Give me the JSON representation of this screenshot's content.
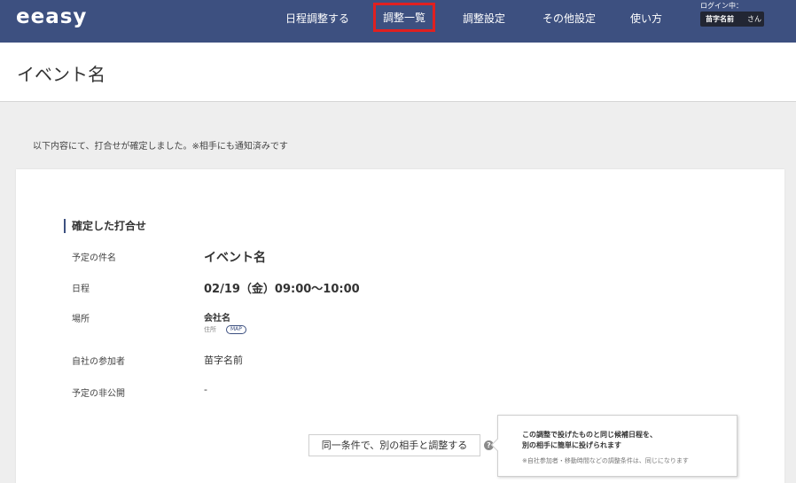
{
  "header": {
    "logo": "eeasy",
    "nav": [
      {
        "label": "日程調整する"
      },
      {
        "label": "調整一覧"
      },
      {
        "label": "調整設定"
      },
      {
        "label": "その他設定"
      },
      {
        "label": "使い方"
      }
    ],
    "active_nav": "調整一覧",
    "login_label": "ログイン中：",
    "user_name": "苗字名前",
    "user_suffix": "さん"
  },
  "page": {
    "title": "イベント名",
    "notice": "以下内容にて、打合せが確定しました。※相手にも通知済みです"
  },
  "card": {
    "section_title": "確定した打合せ",
    "rows": [
      {
        "label": "予定の件名",
        "value": "イベント名"
      },
      {
        "label": "日程",
        "value": "02/19（金）09:00〜10:00"
      },
      {
        "label": "場所",
        "value": "会社名",
        "sub": "住所",
        "badge": "MAP"
      },
      {
        "label": "自社の参加者",
        "value": "苗字名前"
      },
      {
        "label": "予定の非公開",
        "value": "-"
      }
    ],
    "same_condition_button": "同一条件で、別の相手と調整する",
    "help_icon_glyph": "?",
    "tooltip": {
      "line1": "この調整で投げたものと同じ候補日程を、",
      "line2": "別の相手に簡単に投げられます",
      "note": "※自社参加者・移動時間などの調整条件は、同じになります"
    }
  },
  "colors": {
    "header_bg": "#3d5080",
    "active_outline": "#e02020"
  }
}
